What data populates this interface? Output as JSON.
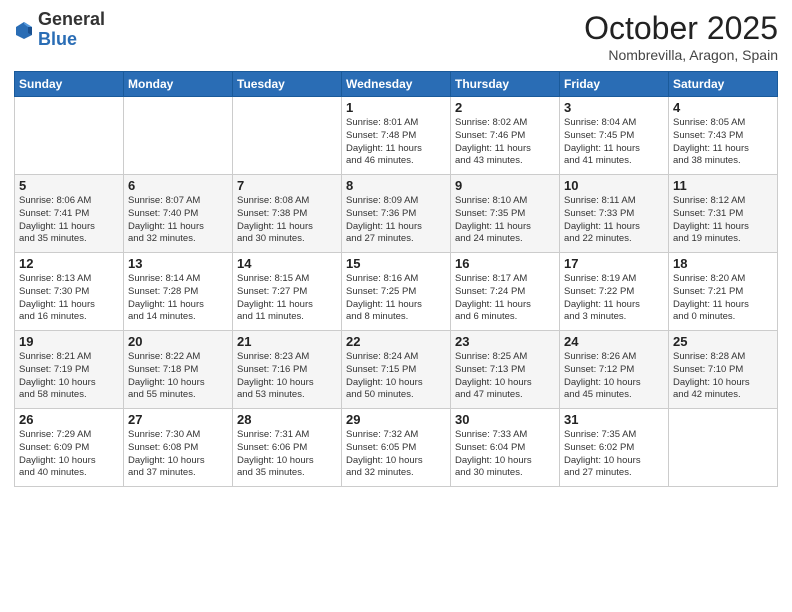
{
  "header": {
    "logo_general": "General",
    "logo_blue": "Blue",
    "month_title": "October 2025",
    "subtitle": "Nombrevilla, Aragon, Spain"
  },
  "days_of_week": [
    "Sunday",
    "Monday",
    "Tuesday",
    "Wednesday",
    "Thursday",
    "Friday",
    "Saturday"
  ],
  "weeks": [
    [
      {
        "day": "",
        "info": ""
      },
      {
        "day": "",
        "info": ""
      },
      {
        "day": "",
        "info": ""
      },
      {
        "day": "1",
        "info": "Sunrise: 8:01 AM\nSunset: 7:48 PM\nDaylight: 11 hours\nand 46 minutes."
      },
      {
        "day": "2",
        "info": "Sunrise: 8:02 AM\nSunset: 7:46 PM\nDaylight: 11 hours\nand 43 minutes."
      },
      {
        "day": "3",
        "info": "Sunrise: 8:04 AM\nSunset: 7:45 PM\nDaylight: 11 hours\nand 41 minutes."
      },
      {
        "day": "4",
        "info": "Sunrise: 8:05 AM\nSunset: 7:43 PM\nDaylight: 11 hours\nand 38 minutes."
      }
    ],
    [
      {
        "day": "5",
        "info": "Sunrise: 8:06 AM\nSunset: 7:41 PM\nDaylight: 11 hours\nand 35 minutes."
      },
      {
        "day": "6",
        "info": "Sunrise: 8:07 AM\nSunset: 7:40 PM\nDaylight: 11 hours\nand 32 minutes."
      },
      {
        "day": "7",
        "info": "Sunrise: 8:08 AM\nSunset: 7:38 PM\nDaylight: 11 hours\nand 30 minutes."
      },
      {
        "day": "8",
        "info": "Sunrise: 8:09 AM\nSunset: 7:36 PM\nDaylight: 11 hours\nand 27 minutes."
      },
      {
        "day": "9",
        "info": "Sunrise: 8:10 AM\nSunset: 7:35 PM\nDaylight: 11 hours\nand 24 minutes."
      },
      {
        "day": "10",
        "info": "Sunrise: 8:11 AM\nSunset: 7:33 PM\nDaylight: 11 hours\nand 22 minutes."
      },
      {
        "day": "11",
        "info": "Sunrise: 8:12 AM\nSunset: 7:31 PM\nDaylight: 11 hours\nand 19 minutes."
      }
    ],
    [
      {
        "day": "12",
        "info": "Sunrise: 8:13 AM\nSunset: 7:30 PM\nDaylight: 11 hours\nand 16 minutes."
      },
      {
        "day": "13",
        "info": "Sunrise: 8:14 AM\nSunset: 7:28 PM\nDaylight: 11 hours\nand 14 minutes."
      },
      {
        "day": "14",
        "info": "Sunrise: 8:15 AM\nSunset: 7:27 PM\nDaylight: 11 hours\nand 11 minutes."
      },
      {
        "day": "15",
        "info": "Sunrise: 8:16 AM\nSunset: 7:25 PM\nDaylight: 11 hours\nand 8 minutes."
      },
      {
        "day": "16",
        "info": "Sunrise: 8:17 AM\nSunset: 7:24 PM\nDaylight: 11 hours\nand 6 minutes."
      },
      {
        "day": "17",
        "info": "Sunrise: 8:19 AM\nSunset: 7:22 PM\nDaylight: 11 hours\nand 3 minutes."
      },
      {
        "day": "18",
        "info": "Sunrise: 8:20 AM\nSunset: 7:21 PM\nDaylight: 11 hours\nand 0 minutes."
      }
    ],
    [
      {
        "day": "19",
        "info": "Sunrise: 8:21 AM\nSunset: 7:19 PM\nDaylight: 10 hours\nand 58 minutes."
      },
      {
        "day": "20",
        "info": "Sunrise: 8:22 AM\nSunset: 7:18 PM\nDaylight: 10 hours\nand 55 minutes."
      },
      {
        "day": "21",
        "info": "Sunrise: 8:23 AM\nSunset: 7:16 PM\nDaylight: 10 hours\nand 53 minutes."
      },
      {
        "day": "22",
        "info": "Sunrise: 8:24 AM\nSunset: 7:15 PM\nDaylight: 10 hours\nand 50 minutes."
      },
      {
        "day": "23",
        "info": "Sunrise: 8:25 AM\nSunset: 7:13 PM\nDaylight: 10 hours\nand 47 minutes."
      },
      {
        "day": "24",
        "info": "Sunrise: 8:26 AM\nSunset: 7:12 PM\nDaylight: 10 hours\nand 45 minutes."
      },
      {
        "day": "25",
        "info": "Sunrise: 8:28 AM\nSunset: 7:10 PM\nDaylight: 10 hours\nand 42 minutes."
      }
    ],
    [
      {
        "day": "26",
        "info": "Sunrise: 7:29 AM\nSunset: 6:09 PM\nDaylight: 10 hours\nand 40 minutes."
      },
      {
        "day": "27",
        "info": "Sunrise: 7:30 AM\nSunset: 6:08 PM\nDaylight: 10 hours\nand 37 minutes."
      },
      {
        "day": "28",
        "info": "Sunrise: 7:31 AM\nSunset: 6:06 PM\nDaylight: 10 hours\nand 35 minutes."
      },
      {
        "day": "29",
        "info": "Sunrise: 7:32 AM\nSunset: 6:05 PM\nDaylight: 10 hours\nand 32 minutes."
      },
      {
        "day": "30",
        "info": "Sunrise: 7:33 AM\nSunset: 6:04 PM\nDaylight: 10 hours\nand 30 minutes."
      },
      {
        "day": "31",
        "info": "Sunrise: 7:35 AM\nSunset: 6:02 PM\nDaylight: 10 hours\nand 27 minutes."
      },
      {
        "day": "",
        "info": ""
      }
    ]
  ]
}
